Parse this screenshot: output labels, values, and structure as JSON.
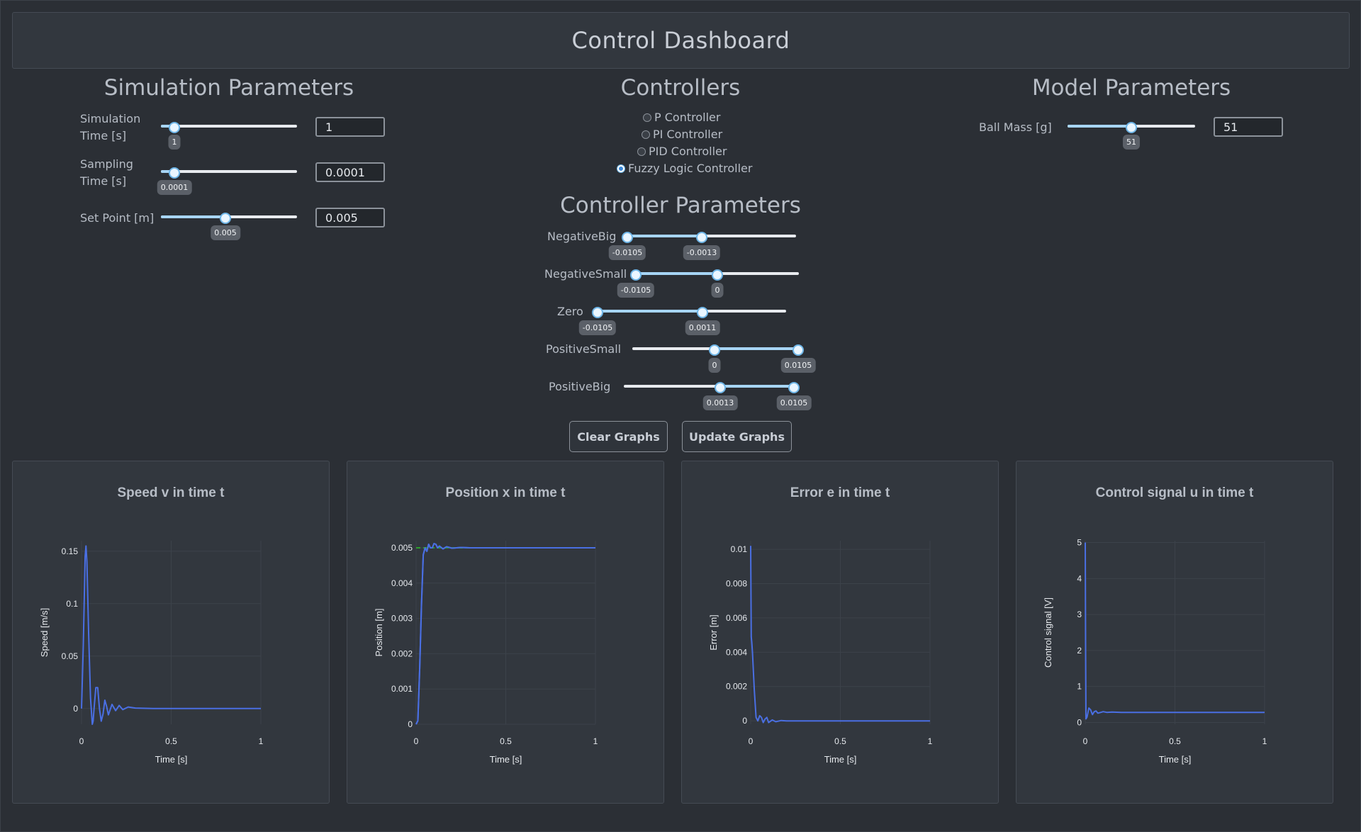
{
  "header": {
    "title": "Control Dashboard"
  },
  "simulation": {
    "title": "Simulation Parameters",
    "params": [
      {
        "label_line1": "Simulation",
        "label_line2": "Time [s]",
        "value": "1",
        "slider_value": "1",
        "slider_position": 0.1
      },
      {
        "label_line1": "Sampling",
        "label_line2": "Time [s]",
        "value": "0.0001",
        "slider_value": "0.0001",
        "slider_position": 0.1
      },
      {
        "label_line1": "Set Point [m]",
        "label_line2": "",
        "value": "0.005",
        "slider_value": "0.005",
        "slider_position": 0.47
      }
    ]
  },
  "controllers": {
    "title": "Controllers",
    "options": [
      {
        "label": "P Controller",
        "selected": false
      },
      {
        "label": "PI Controller",
        "selected": false
      },
      {
        "label": "PID Controller",
        "selected": false
      },
      {
        "label": "Fuzzy Logic Controller",
        "selected": true
      }
    ]
  },
  "controller_params": {
    "title": "Controller Parameters",
    "sets": [
      {
        "label": "NegativeBig",
        "low": "-0.0105",
        "high": "-0.0013",
        "range": [
          0.0,
          0.44
        ]
      },
      {
        "label": "NegativeSmall",
        "low": "-0.0105",
        "high": "0",
        "range": [
          0.0,
          0.5
        ]
      },
      {
        "label": "Zero",
        "low": "-0.0105",
        "high": "0.0011",
        "range": [
          0.0,
          0.55
        ]
      },
      {
        "label": "PositiveSmall",
        "low": "0",
        "high": "0.0105",
        "range": [
          0.5,
          1.0
        ]
      },
      {
        "label": "PositiveBig",
        "low": "0.0013",
        "high": "0.0105",
        "range": [
          0.56,
          1.0
        ]
      }
    ]
  },
  "model": {
    "title": "Model Parameters",
    "mass_label": "Ball Mass [g]",
    "mass_value": "51",
    "mass_slider_value": "51",
    "mass_slider_position": 0.5
  },
  "buttons": {
    "clear": "Clear Graphs",
    "update": "Update Graphs"
  },
  "colors": {
    "accent": "#6fb6e8",
    "trace": "#4a6fe3",
    "setpoint": "#2ca02c",
    "background": "#2b2f35",
    "panel": "#32373e"
  },
  "charts": [
    {
      "title": "Speed v in time t",
      "ylabel": "Speed [m/s]",
      "xlabel": "Time [s]",
      "xticks": [
        "0",
        "0.5",
        "1"
      ],
      "yticks": [
        "0",
        "0.05",
        "0.1",
        "0.15"
      ],
      "chart_data": {
        "type": "line",
        "xlim": [
          0,
          1
        ],
        "ylim": [
          -0.015,
          0.16
        ],
        "yticks": [
          0,
          0.05,
          0.1,
          0.15
        ],
        "series": [
          {
            "x": [
              0,
              0.01,
              0.02,
              0.025,
              0.03,
              0.04,
              0.05,
              0.06,
              0.065,
              0.07,
              0.08,
              0.09,
              0.1,
              0.11,
              0.12,
              0.13,
              0.14,
              0.15,
              0.17,
              0.19,
              0.21,
              0.23,
              0.26,
              0.3,
              0.4,
              0.6,
              0.8,
              1.0
            ],
            "y": [
              0,
              0.06,
              0.145,
              0.155,
              0.14,
              0.07,
              0.01,
              -0.015,
              -0.012,
              0.0,
              0.02,
              0.02,
              0.0,
              -0.012,
              -0.005,
              0.008,
              0.002,
              -0.006,
              0.004,
              -0.002,
              0.003,
              -0.001,
              0.0015,
              0.0005,
              0.0,
              0.0,
              0.0,
              0.0
            ]
          }
        ]
      }
    },
    {
      "title": "Position x in time t",
      "ylabel": "Position [m]",
      "xlabel": "Time [s]",
      "xticks": [
        "0",
        "0.5",
        "1"
      ],
      "yticks": [
        "0",
        "0.001",
        "0.002",
        "0.003",
        "0.004",
        "0.005"
      ],
      "chart_data": {
        "type": "line",
        "xlim": [
          0,
          1
        ],
        "ylim": [
          0,
          0.0052
        ],
        "yticks": [
          0,
          0.001,
          0.002,
          0.003,
          0.004,
          0.005
        ],
        "series": [
          {
            "x": [
              0,
              0.01,
              0.02,
              0.03,
              0.04,
              0.05,
              0.06,
              0.07,
              0.08,
              0.09,
              0.1,
              0.11,
              0.12,
              0.13,
              0.15,
              0.17,
              0.2,
              0.25,
              0.3,
              0.5,
              0.75,
              1.0
            ],
            "y": [
              0,
              0.0001,
              0.0016,
              0.0034,
              0.0048,
              0.005,
              0.0049,
              0.0051,
              0.005,
              0.005,
              0.00512,
              0.0051,
              0.005,
              0.00505,
              0.00497,
              0.00503,
              0.00499,
              0.00501,
              0.005,
              0.005,
              0.005,
              0.005
            ]
          },
          {
            "x": [
              0,
              1
            ],
            "y": [
              0.005,
              0.005
            ],
            "dashed": true
          }
        ]
      }
    },
    {
      "title": "Error e in time t",
      "ylabel": "Error [m]",
      "xlabel": "Time [s]",
      "xticks": [
        "0",
        "0.5",
        "1"
      ],
      "yticks": [
        "0",
        "0.002",
        "0.004",
        "0.006",
        "0.008",
        "0.01"
      ],
      "chart_data": {
        "type": "line",
        "xlim": [
          0,
          1
        ],
        "ylim": [
          -0.0002,
          0.0105
        ],
        "yticks": [
          0,
          0.002,
          0.004,
          0.006,
          0.008,
          0.01
        ],
        "series": [
          {
            "x": [
              0,
              0.003,
              0.006,
              0.01,
              0.02,
              0.03,
              0.04,
              0.05,
              0.06,
              0.07,
              0.08,
              0.09,
              0.1,
              0.12,
              0.14,
              0.17,
              0.2,
              0.3,
              0.5,
              0.75,
              1.0
            ],
            "y": [
              0.0102,
              0.0049,
              0.0046,
              0.004,
              0.0018,
              0.0002,
              0.0,
              0.0003,
              0.0002,
              -0.0001,
              0.0001,
              0.0002,
              -0.0001,
              5e-05,
              -5e-05,
              2e-05,
              0.0,
              0.0,
              0.0,
              0.0,
              0.0
            ]
          }
        ]
      }
    },
    {
      "title": "Control signal u in time t",
      "ylabel": "Control signal [V]",
      "xlabel": "Time [s]",
      "xticks": [
        "0",
        "0.5",
        "1"
      ],
      "yticks": [
        "0",
        "1",
        "2",
        "3",
        "4",
        "5"
      ],
      "chart_data": {
        "type": "line",
        "xlim": [
          0,
          1
        ],
        "ylim": [
          -0.05,
          5.05
        ],
        "yticks": [
          0,
          1,
          2,
          3,
          4,
          5
        ],
        "series": [
          {
            "x": [
              0,
              0.002,
              0.004,
              0.01,
              0.02,
              0.03,
              0.04,
              0.05,
              0.06,
              0.07,
              0.08,
              0.1,
              0.12,
              0.15,
              0.2,
              0.3,
              0.5,
              0.75,
              1.0
            ],
            "y": [
              5.0,
              2.0,
              0.1,
              0.15,
              0.4,
              0.35,
              0.22,
              0.3,
              0.32,
              0.26,
              0.27,
              0.3,
              0.28,
              0.29,
              0.28,
              0.28,
              0.28,
              0.28,
              0.28
            ]
          }
        ]
      }
    }
  ]
}
